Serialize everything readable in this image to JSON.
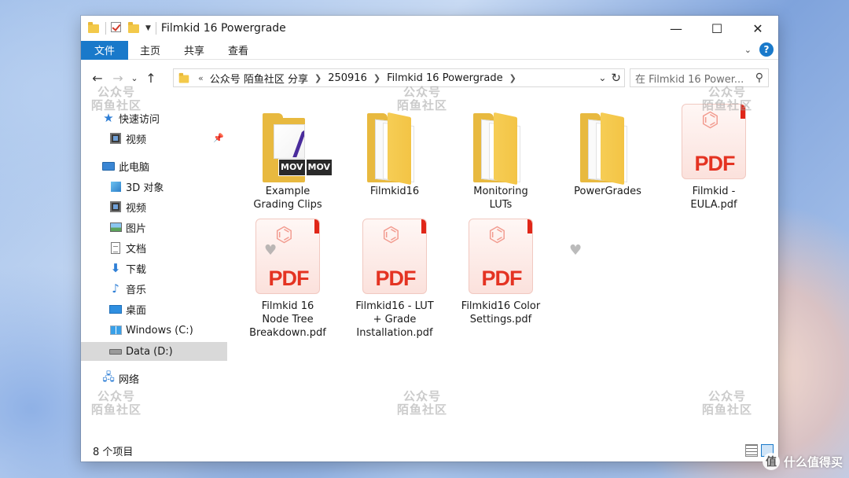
{
  "window": {
    "title": "Filmkid 16 Powergrade",
    "controls": {
      "minimize": "—",
      "maximize": "☐",
      "close": "✕"
    }
  },
  "ribbon": {
    "tabs": [
      {
        "label": "文件",
        "active": true
      },
      {
        "label": "主页",
        "active": false
      },
      {
        "label": "共享",
        "active": false
      },
      {
        "label": "查看",
        "active": false
      }
    ],
    "help": "?"
  },
  "address": {
    "prefix": "«",
    "crumbs": [
      "公众号 陌鱼社区 分享",
      "250916",
      "Filmkid 16 Powergrade"
    ],
    "search_placeholder": "在 Filmkid 16 Power..."
  },
  "nav": {
    "items": [
      {
        "label": "快速访问",
        "icon": "star-icon"
      },
      {
        "label": "视频",
        "icon": "video-icon",
        "pinned": true
      },
      {
        "label": "此电脑",
        "icon": "this-pc-icon"
      },
      {
        "label": "3D 对象",
        "icon": "3d-objects-icon"
      },
      {
        "label": "视频",
        "icon": "video-icon"
      },
      {
        "label": "图片",
        "icon": "pictures-icon"
      },
      {
        "label": "文档",
        "icon": "documents-icon"
      },
      {
        "label": "下载",
        "icon": "downloads-icon"
      },
      {
        "label": "音乐",
        "icon": "music-icon"
      },
      {
        "label": "桌面",
        "icon": "desktop-icon"
      },
      {
        "label": "Windows (C:)",
        "icon": "windows-drive-icon"
      },
      {
        "label": "Data (D:)",
        "icon": "drive-icon",
        "selected": true
      },
      {
        "label": "网络",
        "icon": "network-icon"
      }
    ]
  },
  "files": [
    {
      "name": "Example\nGrading Clips",
      "type": "folder-video",
      "badge": [
        "MOV",
        "MOV"
      ]
    },
    {
      "name": "Filmkid16",
      "type": "folder"
    },
    {
      "name": "Monitoring\nLUTs",
      "type": "folder"
    },
    {
      "name": "PowerGrades",
      "type": "folder"
    },
    {
      "name": "Filmkid -\nEULA.pdf",
      "type": "pdf",
      "icon_label": "PDF"
    },
    {
      "name": "Filmkid 16\nNode Tree\nBreakdown.pdf",
      "type": "pdf",
      "icon_label": "PDF"
    },
    {
      "name": "Filmkid16 - LUT\n+ Grade\nInstallation.pdf",
      "type": "pdf",
      "icon_label": "PDF"
    },
    {
      "name": "Filmkid16 Color\nSettings.pdf",
      "type": "pdf",
      "icon_label": "PDF"
    }
  ],
  "status": {
    "item_count": "8 个项目"
  },
  "watermark": {
    "line1": "公众号",
    "line2": "陌鱼社区"
  },
  "brand": {
    "logo": "值",
    "text": "什么值得买"
  },
  "colors": {
    "accent": "#1979ca",
    "pdf_red": "#e43322",
    "folder": "#f3c445"
  }
}
